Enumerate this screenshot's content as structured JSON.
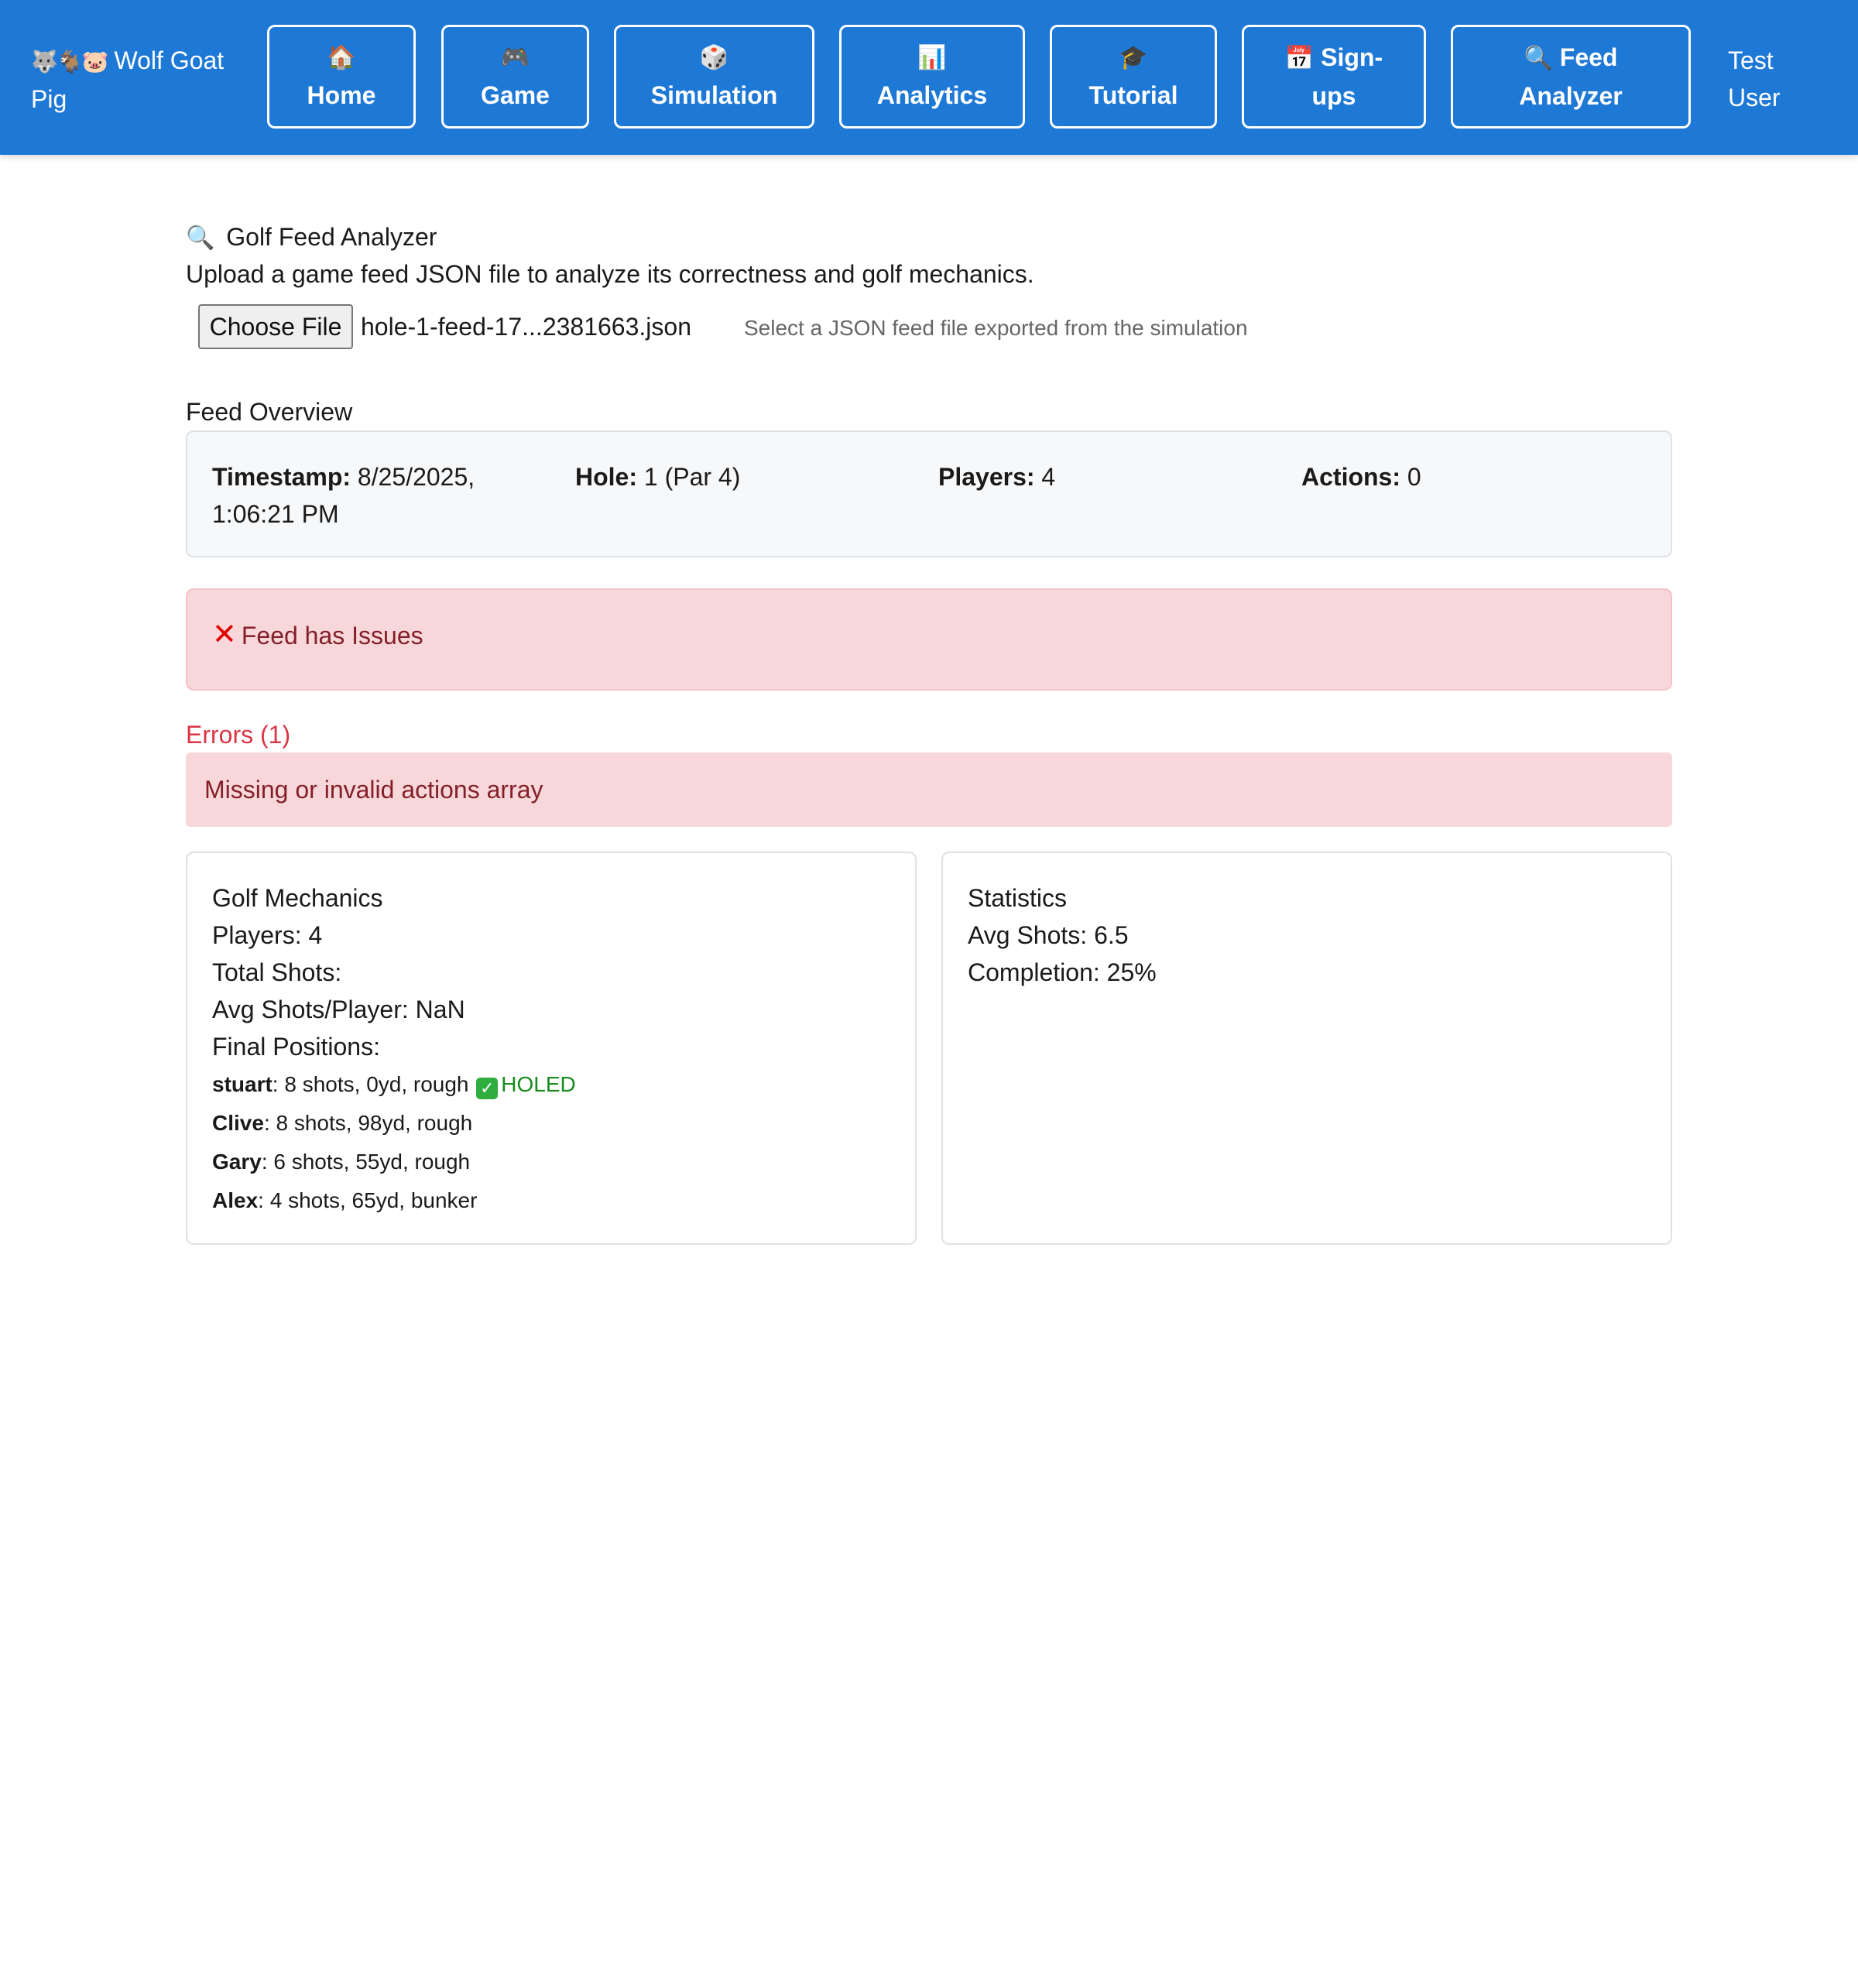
{
  "header": {
    "brand_emoji": "🐺🐐🐷",
    "brand_name": "Wolf Goat Pig",
    "nav": [
      {
        "icon": "🏠",
        "label": "Home"
      },
      {
        "icon": "🎮",
        "label": "Game"
      },
      {
        "icon": "🎲",
        "label": "Simulation"
      },
      {
        "icon": "📊",
        "label": "Analytics"
      },
      {
        "icon": "🎓",
        "label": "Tutorial"
      },
      {
        "icon": "📅",
        "label": "Sign-ups"
      },
      {
        "icon": "🔍",
        "label": "Feed Analyzer"
      }
    ],
    "user": "Test User"
  },
  "page": {
    "title_icon": "🔍",
    "title": "Golf Feed Analyzer",
    "intro": "Upload a game feed JSON file to analyze its correctness and golf mechanics.",
    "file_button": "Choose File",
    "file_name": "hole-1-feed-17...2381663.json",
    "file_hint": "Select a JSON feed file exported from the simulation"
  },
  "overview": {
    "label": "Feed Overview",
    "timestamp_label": "Timestamp:",
    "timestamp_value": "8/25/2025, 1:06:21 PM",
    "hole_label": "Hole:",
    "hole_value": "1 (Par 4)",
    "players_label": "Players:",
    "players_value": "4",
    "actions_label": "Actions:",
    "actions_value": "0"
  },
  "status": {
    "icon": "❌",
    "text": "Feed has Issues"
  },
  "errors": {
    "label": "Errors (1)",
    "items": [
      "Missing or invalid actions array"
    ]
  },
  "mechanics": {
    "title": "Golf Mechanics",
    "players": "Players: 4",
    "total_shots": "Total Shots:",
    "avg_shots": "Avg Shots/Player: NaN",
    "final_positions_label": "Final Positions:",
    "positions": [
      {
        "name": "stuart",
        "detail": ": 8 shots, 0yd, rough",
        "badge": "HOLED"
      },
      {
        "name": "Clive",
        "detail": ": 8 shots, 98yd, rough",
        "badge": ""
      },
      {
        "name": "Gary",
        "detail": ": 6 shots, 55yd, rough",
        "badge": ""
      },
      {
        "name": "Alex",
        "detail": ": 4 shots, 65yd, bunker",
        "badge": ""
      }
    ]
  },
  "statistics": {
    "title": "Statistics",
    "avg_shots": "Avg Shots: 6.5",
    "completion": "Completion: 25%"
  },
  "colors": {
    "header_bg": "#1e78d6",
    "danger_bg": "#f8d7da",
    "danger_text": "#842029",
    "error_label": "#dc3545",
    "holed": "#198a1d"
  }
}
